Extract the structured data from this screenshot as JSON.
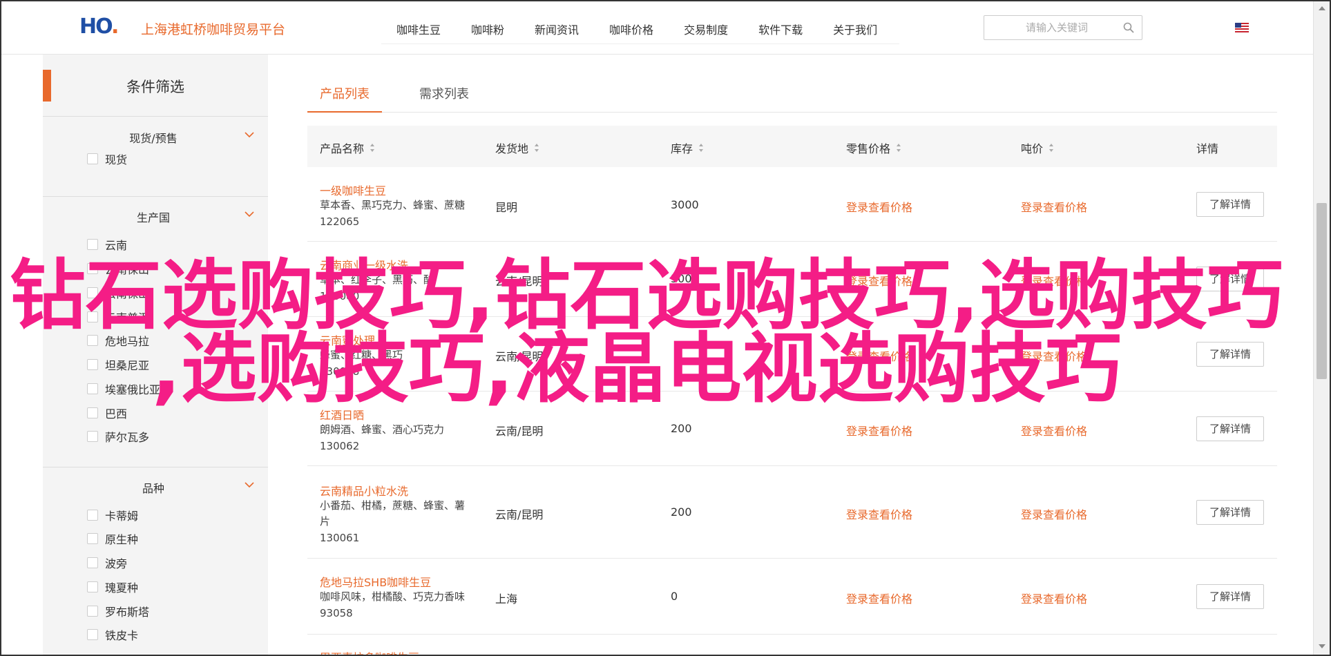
{
  "header": {
    "logo_text": "HO",
    "site_title": "上海港虹桥咖啡贸易平台",
    "nav": [
      "咖啡生豆",
      "咖啡粉",
      "新闻资讯",
      "咖啡价格",
      "交易制度",
      "软件下载",
      "关于我们"
    ],
    "search_placeholder": "请输入关键词",
    "language_icon": "us-flag-icon"
  },
  "sidebar": {
    "title": "条件筛选",
    "groups": [
      {
        "label": "现货/预售",
        "options": [
          "现货"
        ]
      },
      {
        "label": "生产国",
        "options": [
          "云南",
          "云南保山",
          "云南保山",
          "云南普洱",
          "危地马拉",
          "坦桑尼亚",
          "埃塞俄比亚",
          "巴西",
          "萨尔瓦多"
        ]
      },
      {
        "label": "品种",
        "options": [
          "卡蒂姆",
          "原生种",
          "波旁",
          "瑰夏种",
          "罗布斯塔",
          "铁皮卡"
        ]
      }
    ]
  },
  "tabs": [
    "产品列表",
    "需求列表"
  ],
  "table": {
    "columns": [
      "产品名称",
      "发货地",
      "库存",
      "零售价格",
      "吨价",
      "详情"
    ],
    "price_text": "登录查看价格",
    "detail_label": "了解详情",
    "rows": [
      {
        "name": "一级咖啡生豆",
        "desc": [
          "草本香、黑巧克力、蜂蜜、蔗糖"
        ],
        "id": "122065",
        "origin": "昆明",
        "stock": "3000"
      },
      {
        "name": "云南商业一级水洗",
        "desc": [
          "草本、红李子、黑巧、酸"
        ],
        "id": "130080",
        "origin": "云南/昆明",
        "stock": "3000"
      },
      {
        "name": "云南蜜处理",
        "desc": [
          "蜂蜜、红糖、黑巧"
        ],
        "id": "130058",
        "origin": "云南/昆明",
        "stock": ""
      },
      {
        "name": "红酒日晒",
        "desc": [
          "朗姆酒、蜂蜜、酒心巧克力"
        ],
        "id": "130062",
        "origin": "云南/昆明",
        "stock": "200"
      },
      {
        "name": "云南精品小粒水洗",
        "desc": [
          "小番茄、柑橘，蔗糖、蜂蜜、薯",
          "片"
        ],
        "id": "130061",
        "origin": "云南/昆明",
        "stock": "200"
      },
      {
        "name": "危地马拉SHB咖啡生豆",
        "desc": [
          "咖啡风味，柑橘酸、巧克力香味"
        ],
        "id": "93058",
        "origin": "上海",
        "stock": "0"
      }
    ],
    "partial_row_name": "巴西喜拉多咖啡生豆"
  },
  "overlay": {
    "line1": "钻石选购技巧,钻石选购技巧,选购技巧",
    "line2": ",选购技巧,液晶电视选购技巧"
  },
  "colors": {
    "accent": "#e8692c",
    "overlay": "#f41d86",
    "brand_blue": "#1f4fa5"
  }
}
